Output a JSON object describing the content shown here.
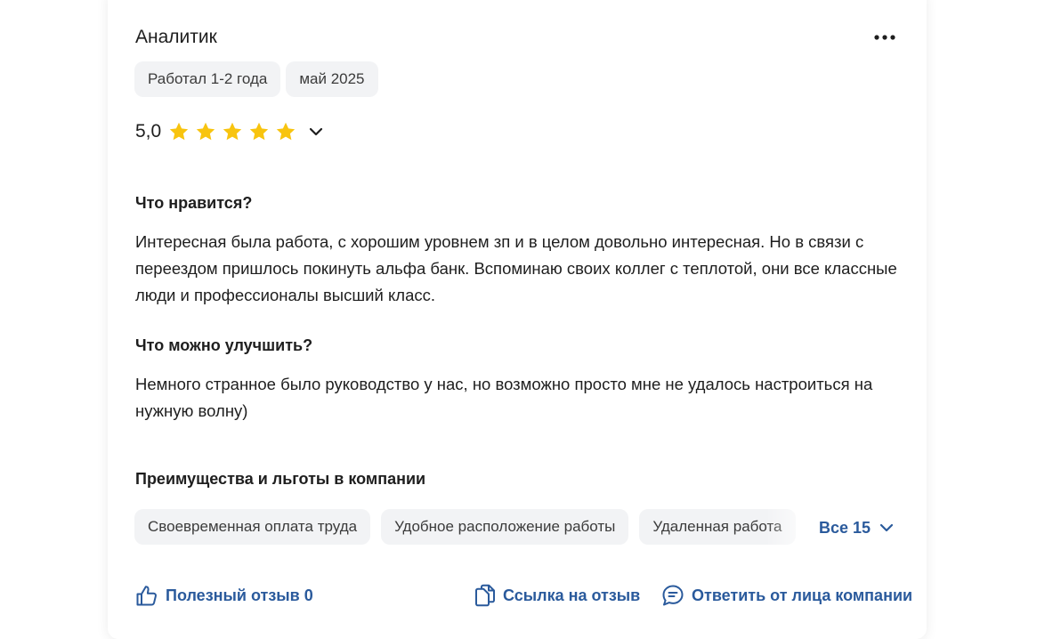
{
  "review": {
    "title": "Аналитик",
    "tags": [
      "Работал 1-2 года",
      "май 2025"
    ],
    "rating": "5,0",
    "stars": 5,
    "colors": {
      "star": "#f8c40f",
      "link": "#2a5a9c",
      "chip_bg": "#f2f3f5"
    },
    "likes_heading": "Что нравится?",
    "likes_text": "Интересная была работа, с хорошим уровнем зп и в целом довольно интересная. Но в связи с переездом пришлось покинуть альфа банк. Вспоминаю своих коллег с теплотой, они все классные люди и профессионалы высший класс.",
    "improve_heading": "Что можно улучшить?",
    "improve_text": "Немного странное было руководство у нас, но возможно просто мне не удалось настроиться на нужную волну)",
    "benefits_heading": "Преимущества и льготы в компании",
    "benefits": [
      "Своевременная оплата труда",
      "Удобное расположение работы",
      "Удаленная работа"
    ],
    "benefits_all": "Все 15"
  },
  "actions": {
    "helpful": "Полезный отзыв 0",
    "link": "Ссылка на отзыв",
    "reply": "Ответить от лица компании"
  },
  "icons": {
    "more": "more-dots-icon",
    "expand": "chevron-down-icon",
    "helpful": "thumbs-up-icon",
    "link": "copy-link-icon",
    "reply": "chat-bubble-icon"
  }
}
